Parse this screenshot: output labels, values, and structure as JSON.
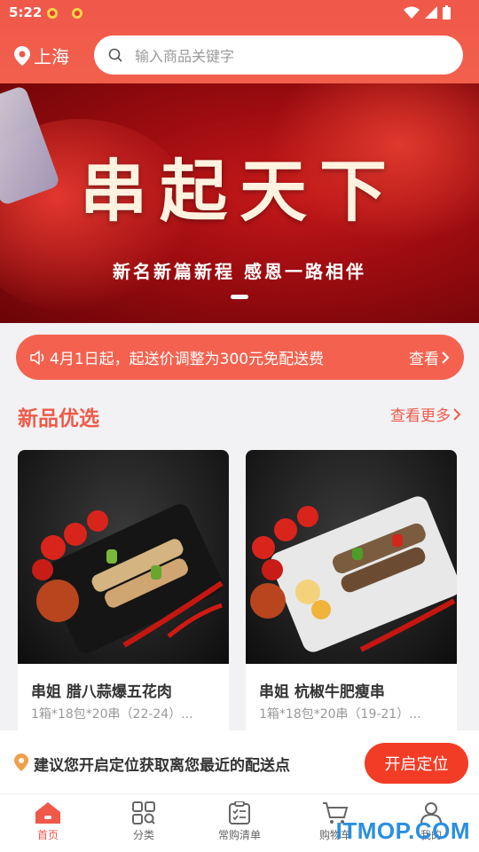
{
  "status_bar": {
    "time": "5:22"
  },
  "header": {
    "location": "上海",
    "search_placeholder": "输入商品关键字"
  },
  "banner": {
    "headline": "串起天下",
    "subline": "新名新篇新程 感恩一路相伴"
  },
  "notice": {
    "message": "4月1日起，起送价调整为300元免配送费",
    "action": "查看"
  },
  "section": {
    "title": "新品优选",
    "more": "查看更多"
  },
  "products": [
    {
      "name": "串姐 腊八蒜爆五花肉",
      "spec": "1箱*18包*20串（22-24）..."
    },
    {
      "name": "串姐 杭椒牛肥瘦串",
      "spec": "1箱*18包*20串（19-21）..."
    }
  ],
  "location_prompt": {
    "message": "建议您开启定位获取离您最近的配送点",
    "button": "开启定位"
  },
  "tabs": [
    {
      "label": "首页",
      "icon": "home-icon",
      "active": true
    },
    {
      "label": "分类",
      "icon": "category-icon",
      "active": false
    },
    {
      "label": "常购清单",
      "icon": "list-icon",
      "active": false
    },
    {
      "label": "购物车",
      "icon": "cart-icon",
      "active": false
    },
    {
      "label": "我的",
      "icon": "user-icon",
      "active": false
    }
  ],
  "watermark": "ITMOP.COM",
  "colors": {
    "accent": "#f0584a",
    "button": "#f23c25"
  }
}
